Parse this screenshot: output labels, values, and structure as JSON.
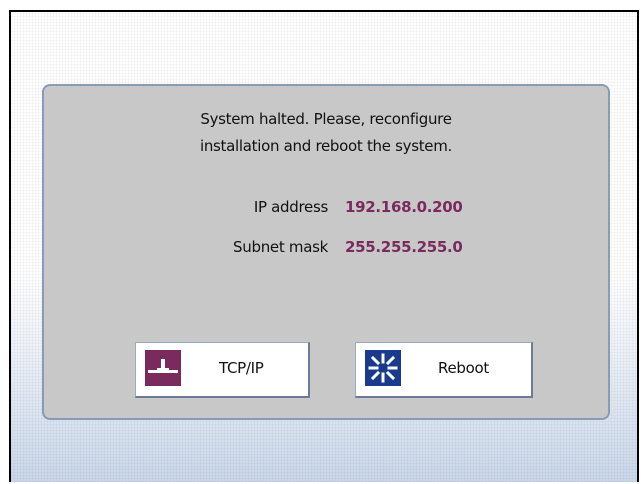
{
  "dialog": {
    "message_line1": "System halted. Please, reconfigure",
    "message_line2": "installation and reboot the system.",
    "fields": [
      {
        "label": "IP address",
        "value": "192.168.0.200"
      },
      {
        "label": "Subnet mask",
        "value": "255.255.255.0"
      }
    ],
    "buttons": {
      "tcpip": {
        "label": "TCP/IP",
        "icon": "network-connection-icon"
      },
      "reboot": {
        "label": "Reboot",
        "icon": "reboot-icon"
      }
    }
  },
  "colors": {
    "value_text": "#7a2a5c",
    "tcpip_icon_bg": "#7a2a5c",
    "reboot_icon_bg": "#1a3a8c",
    "panel_bg": "#c8c8c8",
    "panel_border": "#8a9bb8"
  }
}
